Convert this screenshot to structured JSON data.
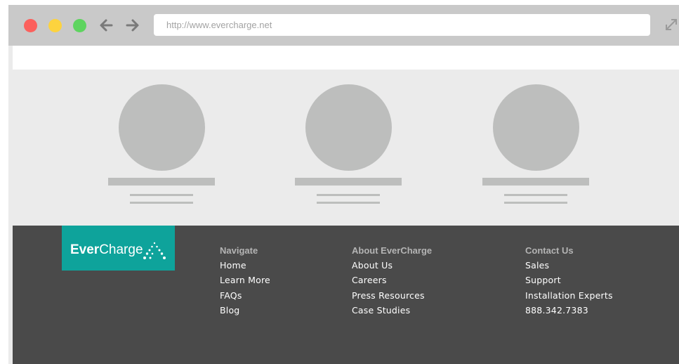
{
  "browser": {
    "url": "http://www.evercharge.net",
    "back_icon": "arrow-left-icon",
    "forward_icon": "arrow-right-icon",
    "expand_icon": "expand-icon"
  },
  "footer": {
    "logo": {
      "ever": "Ever",
      "charge": "Charge",
      "brand_color": "#0ea39b"
    },
    "columns": [
      {
        "heading": "Navigate",
        "links": [
          "Home",
          "Learn More",
          "FAQs",
          "Blog"
        ]
      },
      {
        "heading": "About EverCharge",
        "links": [
          "About Us",
          "Careers",
          "Press Resources",
          "Case Studies"
        ]
      },
      {
        "heading": "Contact Us",
        "links": [
          "Sales",
          "Support",
          "Installation Experts",
          "888.342.7383"
        ]
      }
    ]
  },
  "colors": {
    "chrome": "#c9c9c9",
    "placeholder": "#bdbebd",
    "footer_bg": "#4a4a4a"
  }
}
